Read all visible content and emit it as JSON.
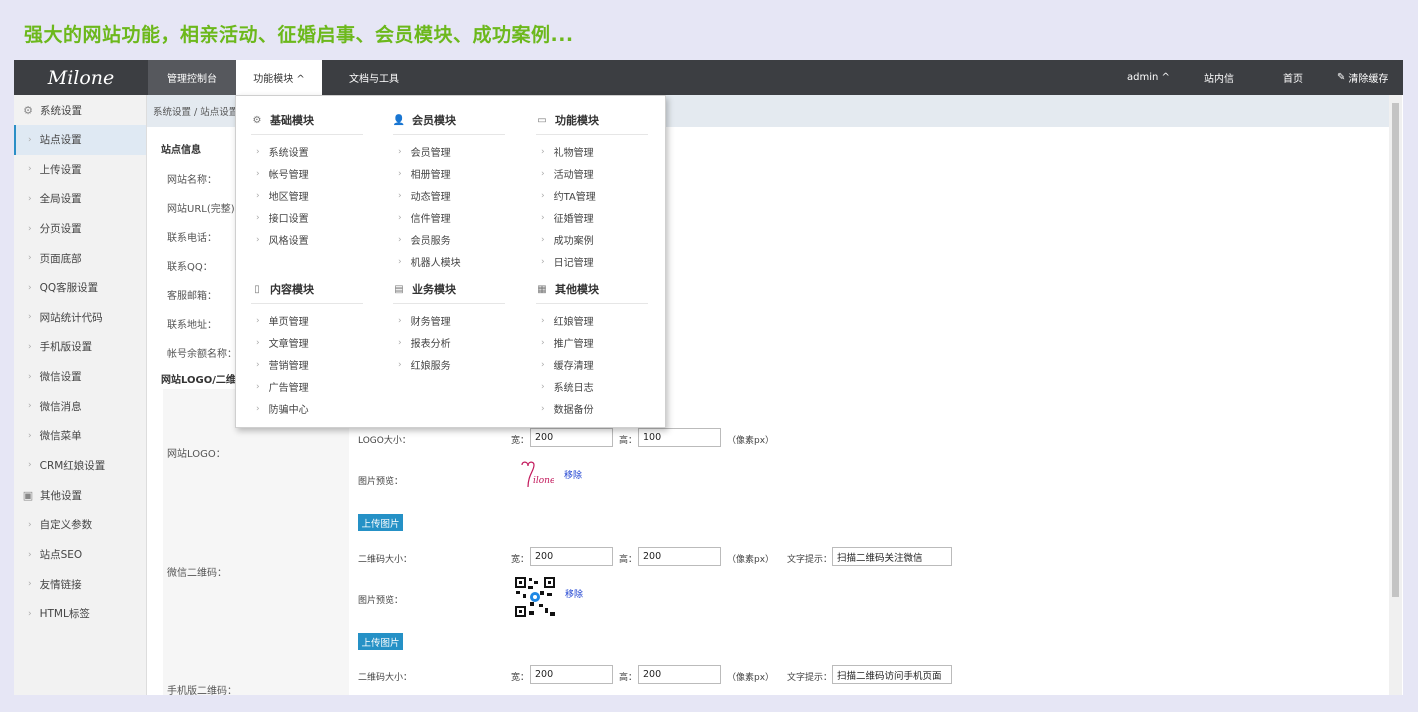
{
  "banner": "强大的网站功能，相亲活动、征婚启事、会员模块、成功案例...",
  "logo": "Milone",
  "topnav": {
    "items": [
      "管理控制台",
      "功能模块 ^",
      "文档与工具"
    ],
    "admin": "admin ^",
    "messages": "站内信",
    "home": "首页",
    "clear_cache": "清除缓存"
  },
  "sidebar": {
    "group1": "系统设置",
    "items1": [
      "站点设置",
      "上传设置",
      "全局设置",
      "分页设置",
      "页面底部",
      "QQ客服设置",
      "网站统计代码",
      "手机版设置",
      "微信设置",
      "微信消息",
      "微信菜单",
      "CRM红娘设置"
    ],
    "group2": "其他设置",
    "items2": [
      "自定义参数",
      "站点SEO",
      "友情链接",
      "HTML标签"
    ]
  },
  "breadcrumb": "系统设置 / 站点设置",
  "form": {
    "section1": "站点信息",
    "labels": [
      "网站名称：",
      "网站URL(完整)：",
      "联系电话：",
      "联系QQ：",
      "客服邮箱：",
      "联系地址：",
      "帐号余额名称："
    ],
    "section2": "网站LOGO/二维",
    "logo_label": "网站LOGO：",
    "logo_size_label": "LOGO大小：",
    "wechat_label": "微信二维码：",
    "mobile_label": "手机版二维码：",
    "qr_size_label": "二维码大小：",
    "preview_label": "图片预览：",
    "width_label": "宽：",
    "height_label": "高：",
    "unit": "（像素px）",
    "hint_label": "文字提示：",
    "upload": "上传图片",
    "remove": "移除",
    "logo_w": "200",
    "logo_h": "100",
    "wx_w": "200",
    "wx_h": "200",
    "wx_hint": "扫描二维码关注微信",
    "m_w": "200",
    "m_h": "200",
    "m_hint": "扫描二维码访问手机页面"
  },
  "dropdown": {
    "col1": {
      "title": "基础模块",
      "items": [
        "系统设置",
        "帐号管理",
        "地区管理",
        "接口设置",
        "风格设置"
      ]
    },
    "col2": {
      "title": "会员模块",
      "items": [
        "会员管理",
        "相册管理",
        "动态管理",
        "信件管理",
        "会员服务",
        "机器人模块"
      ]
    },
    "col3": {
      "title": "功能模块",
      "items": [
        "礼物管理",
        "活动管理",
        "约TA管理",
        "征婚管理",
        "成功案例",
        "日记管理"
      ]
    },
    "col4": {
      "title": "内容模块",
      "items": [
        "单页管理",
        "文章管理",
        "营销管理",
        "广告管理",
        "防骗中心"
      ]
    },
    "col5": {
      "title": "业务模块",
      "items": [
        "财务管理",
        "报表分析",
        "红娘服务"
      ]
    },
    "col6": {
      "title": "其他模块",
      "items": [
        "红娘管理",
        "推广管理",
        "缓存清理",
        "系统日志",
        "数据备份"
      ]
    }
  }
}
